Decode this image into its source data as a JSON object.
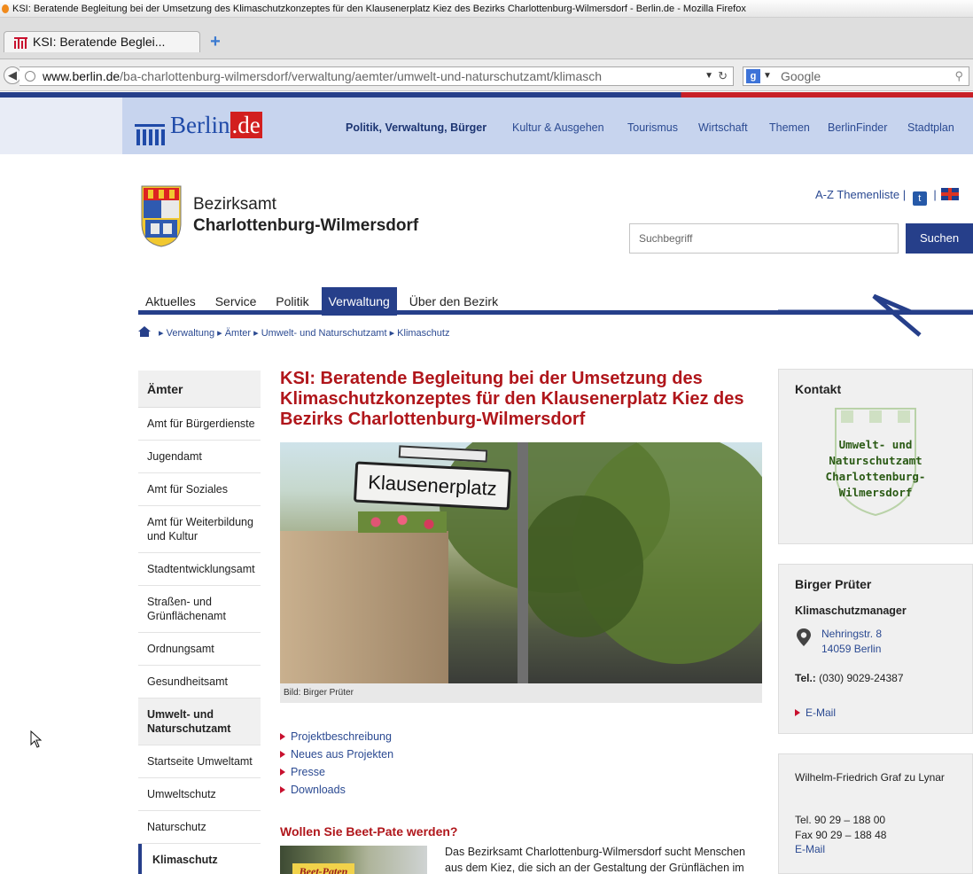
{
  "window": {
    "title": "KSI: Beratende Begleitung bei der Umsetzung des Klimaschutzkonzeptes für den Klausenerplatz Kiez des Bezirks Charlottenburg-Wilmersdorf - Berlin.de - Mozilla Firefox"
  },
  "tab": {
    "label": "KSI: Beratende Beglei...",
    "new_tab": "+"
  },
  "nav": {
    "url_domain": "www.berlin.de",
    "url_path": "/ba-charlottenburg-wilmersdorf/verwaltung/aemter/umwelt-und-naturschutzamt/klimasch",
    "search_engine": "Google"
  },
  "header": {
    "logo_text": "Berlin",
    "logo_suffix": ".de",
    "items": [
      "Politik, Verwaltung, Bürger",
      "Kultur & Ausgehen",
      "Tourismus",
      "Wirtschaft",
      "Themen",
      "BerlinFinder",
      "Stadtplan"
    ]
  },
  "district": {
    "line1": "Bezirksamt",
    "line2": "Charlottenburg-Wilmersdorf"
  },
  "toplinks": {
    "az": "A-Z Themenliste",
    "sep": "|"
  },
  "search": {
    "placeholder": "Suchbegriff",
    "button": "Suchen"
  },
  "mainnav": {
    "items": [
      "Aktuelles",
      "Service",
      "Politik",
      "Verwaltung",
      "Über den Bezirk"
    ]
  },
  "breadcrumb": {
    "items": [
      "Verwaltung",
      "Ämter",
      "Umwelt- und Naturschutzamt",
      "Klimaschutz"
    ]
  },
  "sidebar": {
    "title": "Ämter",
    "items": [
      "Amt für Bürgerdienste",
      "Jugendamt",
      "Amt für Soziales",
      "Amt für Weiterbildung und Kultur",
      "Stadtentwicklungsamt",
      "Straßen- und Grünflächenamt",
      "Ordnungsamt",
      "Gesundheitsamt",
      "Umwelt- und Naturschutzamt",
      "Startseite Umweltamt",
      "Umweltschutz",
      "Naturschutz",
      "Klimaschutz"
    ]
  },
  "content": {
    "title": "KSI: Beratende Begleitung bei der Umsetzung des Klimaschutzkonzeptes für den Klausenerplatz Kiez des Bezirks Charlottenburg-Wilmersdorf",
    "sign_text": "Klausenerplatz",
    "caption": "Bild: Birger Prüter",
    "links": [
      "Projektbeschreibung",
      "Neues aus Projekten",
      "Presse",
      "Downloads"
    ],
    "subtitle": "Wollen Sie Beet-Pate werden?",
    "thumb_text": "Beet-Paten",
    "paragraph": "Das Bezirksamt Charlottenburg-Wilmersdorf sucht Menschen aus dem Kiez, die sich an der Gestaltung der Grünflächen im"
  },
  "contact": {
    "title": "Kontakt",
    "stamp_lines": [
      "Umwelt- und",
      "Naturschutzamt",
      "Charlottenburg-",
      "Wilmersdorf"
    ]
  },
  "person": {
    "name": "Birger Prüter",
    "role": "Klimaschutzmanager",
    "street": "Nehringstr. 8",
    "city": "14059 Berlin",
    "tel_label": "Tel.:",
    "tel": "(030) 9029-24387",
    "email": "E-Mail"
  },
  "person2": {
    "name": "Wilhelm-Friedrich Graf zu Lynar",
    "tel": "Tel. 90 29 – 188 00",
    "fax": "Fax 90 29 – 188 48",
    "email": "E-Mail"
  },
  "colors": {
    "brand_blue": "#263f8a",
    "title_red": "#b0161b",
    "link_blue": "#2b4a92"
  }
}
